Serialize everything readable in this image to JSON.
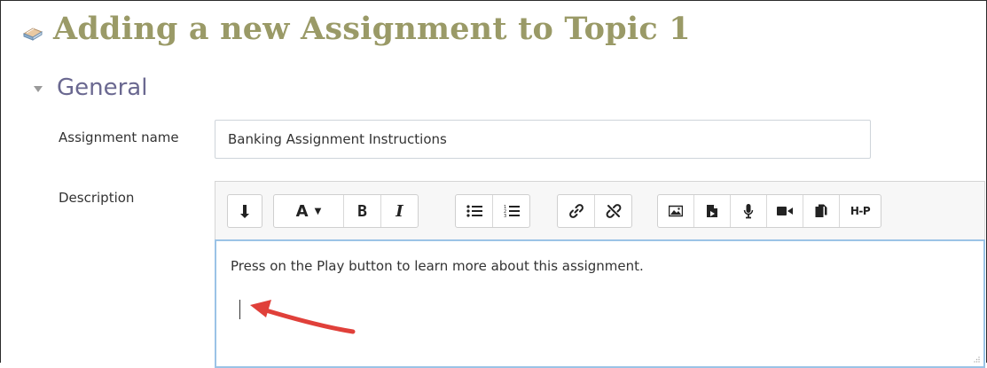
{
  "page": {
    "title": "Adding a new Assignment to Topic 1",
    "title_color": "#9a9a67",
    "module_icon": "assignment-icon"
  },
  "section": {
    "title": "General",
    "title_color": "#6a6890",
    "toggle_icon": "caret-down-icon"
  },
  "form": {
    "name_label": "Assignment name",
    "name_value": "Banking Assignment Instructions",
    "description_label": "Description"
  },
  "toolbar": {
    "groups": [
      [
        "collapse-icon"
      ],
      [
        "text-style-icon",
        "bold-icon",
        "italic-icon"
      ],
      [
        "unordered-list-icon",
        "ordered-list-icon"
      ],
      [
        "link-icon",
        "unlink-icon"
      ],
      [
        "image-icon",
        "media-icon",
        "record-audio-icon",
        "record-video-icon",
        "manage-files-icon",
        "h5p-icon"
      ]
    ],
    "text_style_label": "A",
    "bold_label": "B",
    "italic_label": "I",
    "h5p_label": "H-P"
  },
  "editor": {
    "content": "Press on the Play button to learn more about this assignment.",
    "focus_border_color": "#9bc3e6"
  },
  "annotation": {
    "arrow_color": "#e0403a"
  }
}
